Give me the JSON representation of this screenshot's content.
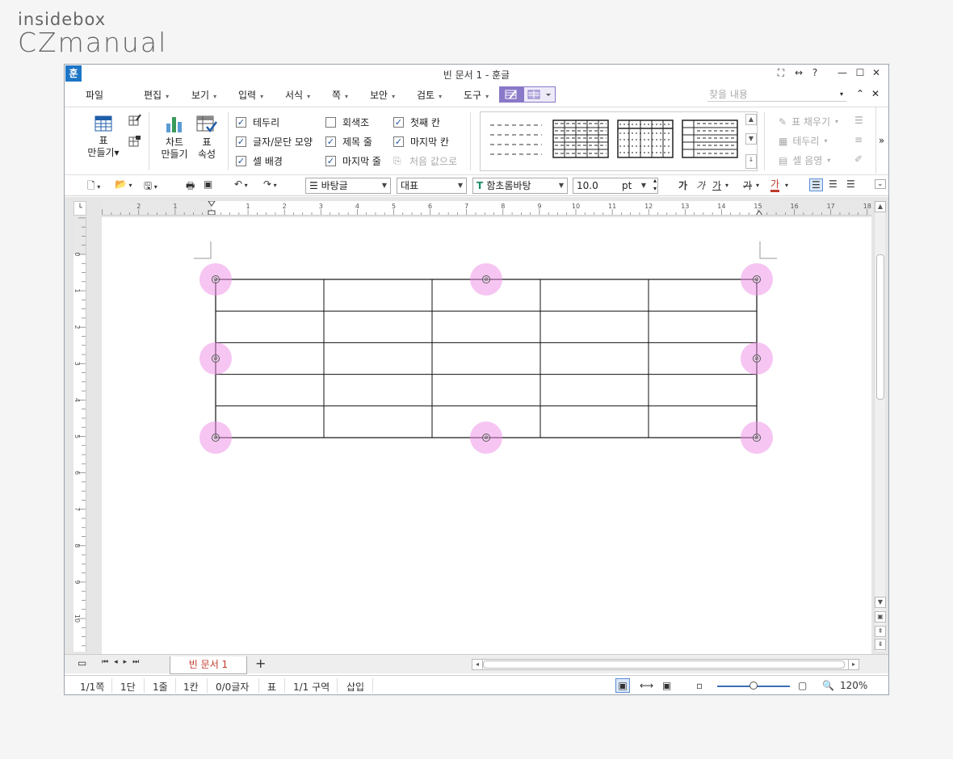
{
  "logo": {
    "line1": "insidebox",
    "line2": "CZmanual"
  },
  "window": {
    "app_icon": "훈",
    "title": "빈 문서 1 - 훈글",
    "controls": [
      "⛶",
      "↔",
      "?",
      "—",
      "☐",
      "✕"
    ]
  },
  "menu": {
    "items": [
      {
        "label": "파일",
        "dd": ""
      },
      {
        "label": "편집",
        "dd": "▾"
      },
      {
        "label": "보기",
        "dd": "▾"
      },
      {
        "label": "입력",
        "dd": "▾"
      },
      {
        "label": "서식",
        "dd": "▾"
      },
      {
        "label": "쪽",
        "dd": "▾"
      },
      {
        "label": "보안",
        "dd": "▾"
      },
      {
        "label": "검토",
        "dd": "▾"
      },
      {
        "label": "도구",
        "dd": "▾"
      }
    ],
    "search_placeholder": "찾을 내용",
    "right_icons": [
      "▾",
      "⌃",
      "✕"
    ]
  },
  "ribbon": {
    "table_make": {
      "line1": "표",
      "line2": "만들기▾"
    },
    "chart_make": {
      "line1": "차트",
      "line2": "만들기"
    },
    "table_props": {
      "line1": "표",
      "line2": "속성"
    },
    "checks": [
      {
        "label": "테두리",
        "checked": true
      },
      {
        "label": "글자/문단 모양",
        "checked": true
      },
      {
        "label": "셀 배경",
        "checked": true
      },
      {
        "label": "회색조",
        "checked": false
      },
      {
        "label": "제목 줄",
        "checked": true
      },
      {
        "label": "마지막 줄",
        "checked": true
      },
      {
        "label": "첫째 칸",
        "checked": true
      },
      {
        "label": "마지막 칸",
        "checked": true
      }
    ],
    "reset": "처음 값으로",
    "fill": "표 채우기",
    "border": "테두리",
    "shade": "셀 음영",
    "more": "»"
  },
  "format": {
    "style": "바탕글",
    "lang": "대표",
    "font": "함초롬바탕",
    "size": "10.0",
    "unit": "pt",
    "char_buttons": [
      "가",
      "가",
      "가",
      "가",
      "가"
    ]
  },
  "ruler": {
    "h": [
      "2",
      "1",
      "1",
      "2",
      "3",
      "4",
      "5",
      "6",
      "7",
      "8",
      "9",
      "10",
      "11",
      "12",
      "13",
      "14",
      "15",
      "16",
      "17",
      "18"
    ],
    "v": [
      "0",
      "1",
      "2",
      "3",
      "4",
      "5",
      "6",
      "7",
      "8",
      "9",
      "10"
    ]
  },
  "tabs": {
    "doc_tab": "빈 문서 1",
    "add": "+"
  },
  "status": {
    "page": "1/1쪽",
    "col": "1단",
    "line": "1줄",
    "cell": "1칸",
    "chars": "0/0글자",
    "table": "표",
    "section": "1/1 구역",
    "mode": "삽입",
    "zoom": "120%"
  },
  "table": {
    "rows": 5,
    "cols": 5
  },
  "colors": {
    "accent": "#1d76c6",
    "handle": "#ee8ce6",
    "doc_tab": "#c0392b"
  }
}
